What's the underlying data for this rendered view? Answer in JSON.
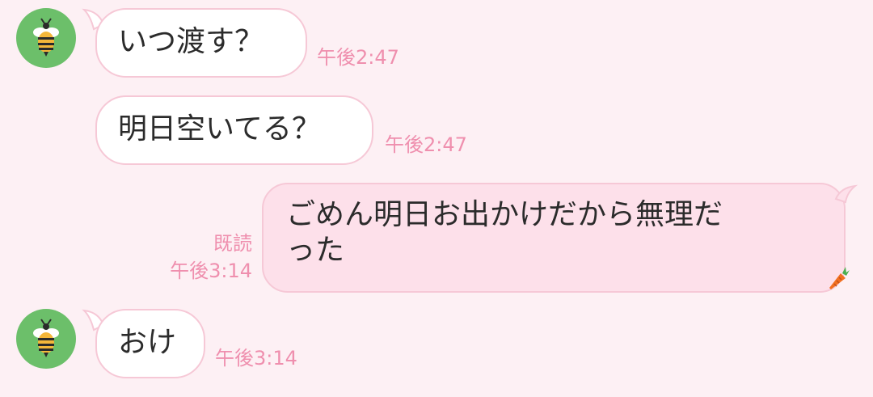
{
  "theme": {
    "background": "#fdf0f4",
    "incoming_bubble": "#ffffff",
    "outgoing_bubble": "#fde0ea",
    "bubble_border": "#f6c8d6",
    "timestamp_color": "#ef8fae",
    "avatar_color": "#6cbf6a"
  },
  "messages": [
    {
      "direction": "incoming",
      "avatar_icon": "bee-icon",
      "text": "いつ渡す？",
      "time": "午後2:47"
    },
    {
      "direction": "incoming",
      "text": "明日空いてる？",
      "time": "午後2:47"
    },
    {
      "direction": "outgoing",
      "read_label": "既読",
      "line1": "ごめん明日お出かけだから無理だ",
      "line2": "った",
      "time": "午後3:14",
      "emoji_icon": "carrot-icon"
    },
    {
      "direction": "incoming",
      "avatar_icon": "bee-icon",
      "text": "おけ",
      "time": "午後3:14"
    }
  ]
}
